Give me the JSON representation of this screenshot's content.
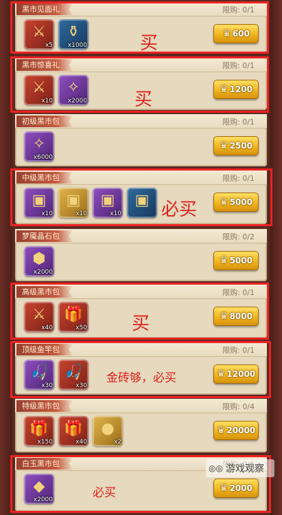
{
  "packs": [
    {
      "title": "黑市见面礼",
      "limit": "限购: 0/1",
      "price": "600",
      "items": [
        {
          "icon": "gold-sword-icon",
          "glyph": "⚔",
          "color": "red",
          "count": "x5"
        },
        {
          "icon": "coffin-icon",
          "glyph": "⚱",
          "color": "blue",
          "count": "x1000"
        }
      ],
      "note": "买"
    },
    {
      "title": "黑市惊喜礼",
      "limit": "限购: 0/1",
      "price": "1200",
      "items": [
        {
          "icon": "gold-sword-icon",
          "glyph": "⚔",
          "color": "red",
          "count": "x10"
        },
        {
          "icon": "crystal-shard-icon",
          "glyph": "✧",
          "color": "purple",
          "count": "x2000"
        }
      ],
      "note": "买"
    },
    {
      "title": "初级黑市包",
      "limit": "限购: 0/1",
      "price": "2500",
      "items": [
        {
          "icon": "crystal-shard-icon",
          "glyph": "✧",
          "color": "purple",
          "count": "x6000"
        }
      ],
      "note": ""
    },
    {
      "title": "中级黑市包",
      "limit": "限购: 0/1",
      "price": "5000",
      "items": [
        {
          "icon": "iron-chest-icon",
          "glyph": "▣",
          "color": "purple",
          "count": "x10"
        },
        {
          "icon": "orange-chest-icon",
          "glyph": "▣",
          "color": "gold",
          "count": "x10"
        },
        {
          "icon": "gold-chest-icon",
          "glyph": "▣",
          "color": "purple",
          "count": "x10"
        },
        {
          "icon": "silver-chest-icon",
          "glyph": "▣",
          "color": "blue",
          "count": ""
        }
      ],
      "note": "必买"
    },
    {
      "title": "梦魇晶石包",
      "limit": "限购: 0/2",
      "price": "5000",
      "items": [
        {
          "icon": "nightmare-crystal-icon",
          "glyph": "⬢",
          "color": "purple",
          "count": "x2000"
        }
      ],
      "note": ""
    },
    {
      "title": "高级黑市包",
      "limit": "限购: 0/1",
      "price": "8000",
      "items": [
        {
          "icon": "gold-sword-icon",
          "glyph": "⚔",
          "color": "red",
          "count": "x40"
        },
        {
          "icon": "gift-box-icon",
          "glyph": "🎁",
          "color": "red",
          "count": "x50"
        }
      ],
      "note": "买"
    },
    {
      "title": "顶级鱼竿包",
      "limit": "限购: 0/1",
      "price": "12000",
      "items": [
        {
          "icon": "fishing-rod-icon",
          "glyph": "🎣",
          "color": "purple",
          "count": "x30"
        },
        {
          "icon": "golden-rod-icon",
          "glyph": "🎣",
          "color": "red",
          "count": "x30"
        }
      ],
      "note": "金砖够，必买"
    },
    {
      "title": "特级黑市包",
      "limit": "限购: 0/4",
      "price": "20000",
      "items": [
        {
          "icon": "gift-box-icon",
          "glyph": "🎁",
          "color": "red",
          "count": "x150"
        },
        {
          "icon": "gift-box-icon",
          "glyph": "🎁",
          "color": "red",
          "count": "x40"
        },
        {
          "icon": "pearl-icon",
          "glyph": "●",
          "color": "gold",
          "count": "x2"
        }
      ],
      "note": ""
    },
    {
      "title": "白玉黑市包",
      "limit": "限购: 0/1",
      "price": "2000",
      "items": [
        {
          "icon": "white-jade-icon",
          "glyph": "◆",
          "color": "purple",
          "count": "x2000"
        }
      ],
      "note": "必买"
    }
  ],
  "watermark": "游戏观察"
}
